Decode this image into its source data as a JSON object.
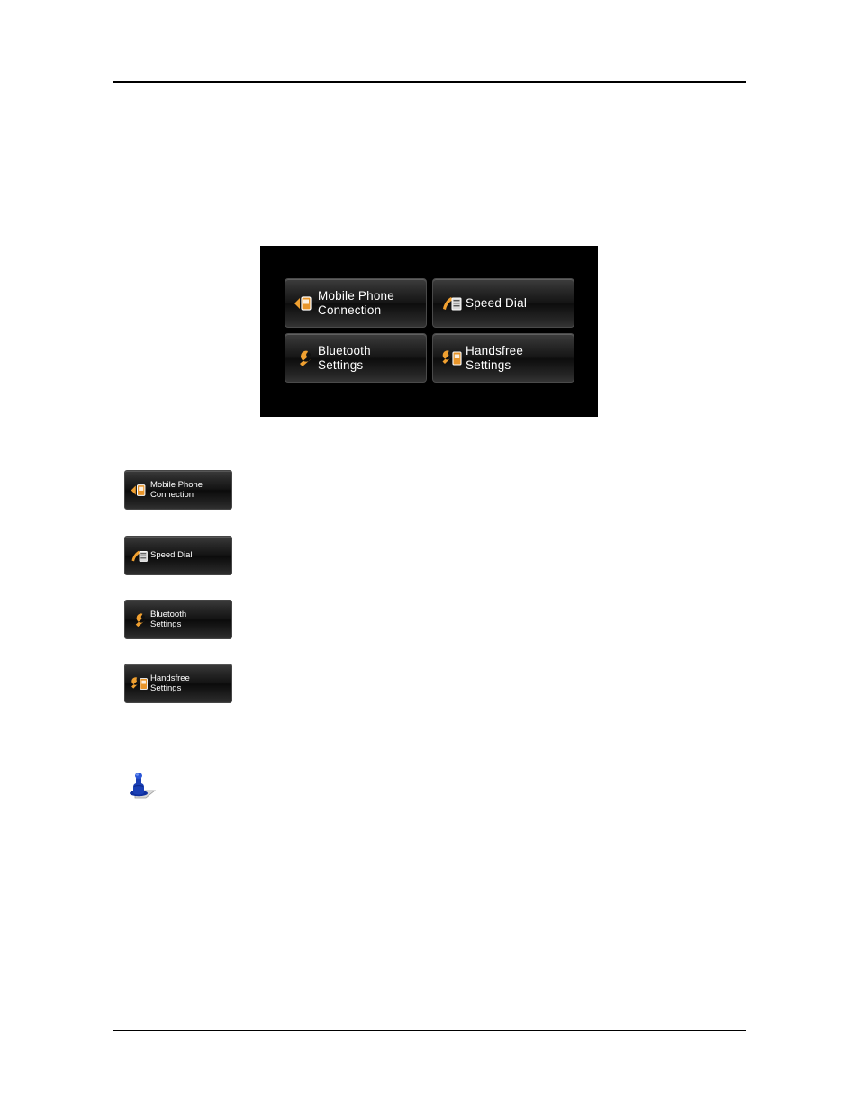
{
  "page": {
    "background_color": "#ffffff",
    "rule_color": "#000000"
  },
  "device_screen": {
    "background_color": "#000000",
    "menu_items": [
      {
        "label": "Mobile Phone\nConnection",
        "icon": "phone-connection-icon"
      },
      {
        "label": "Speed Dial",
        "icon": "speed-dial-icon"
      },
      {
        "label": "Bluetooth\nSettings",
        "icon": "wrench-icon"
      },
      {
        "label": "Handsfree\nSettings",
        "icon": "handsfree-settings-icon"
      }
    ]
  },
  "legend": {
    "items": [
      {
        "label": "Mobile Phone\nConnection",
        "icon": "phone-connection-icon"
      },
      {
        "label": "Speed Dial",
        "icon": "speed-dial-icon"
      },
      {
        "label": "Bluetooth\nSettings",
        "icon": "wrench-icon"
      },
      {
        "label": "Handsfree\nSettings",
        "icon": "handsfree-settings-icon"
      }
    ]
  },
  "note": {
    "icon": "blue-pushpin-note-icon",
    "icon_color": "#1a3fb5"
  }
}
